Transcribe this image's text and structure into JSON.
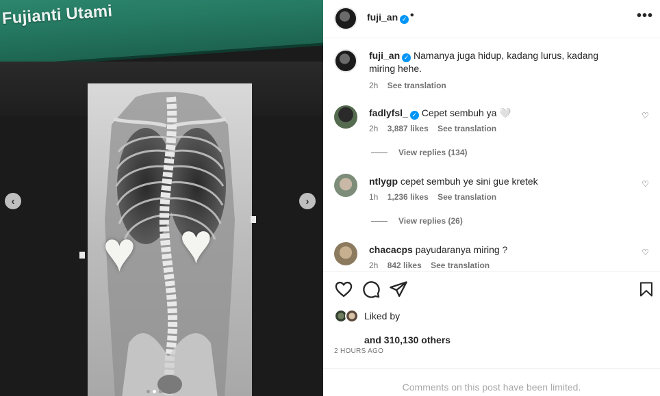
{
  "media": {
    "banner_name": "Fujianti Utami",
    "carousel_dots": 3,
    "active_dot": 2
  },
  "post": {
    "username": "fuji_an",
    "verified": true,
    "more_label": "•••",
    "caption": "Namanya juga hidup, kadang lurus, kadang miring hehe.",
    "caption_time": "2h",
    "see_translation": "See translation"
  },
  "comments": [
    {
      "user": "fadlyfsl_",
      "verified": true,
      "text": "Cepet sembuh ya 🤍",
      "time": "2h",
      "likes": "3,887 likes",
      "translation": "See translation",
      "replies": "View replies (134)"
    },
    {
      "user": "ntlygp",
      "verified": false,
      "text": "cepet sembuh ye sini gue kretek",
      "time": "1h",
      "likes": "1,236 likes",
      "translation": "See translation",
      "replies": "View replies (26)"
    },
    {
      "user": "chacacps",
      "verified": false,
      "text": "payudaranya miring ?",
      "time": "2h",
      "likes": "842 likes",
      "translation": "See translation"
    }
  ],
  "likes": {
    "liked_by": "Liked by",
    "others": "and 310,130 others"
  },
  "timestamp": "2 HOURS AGO",
  "limited_notice": "Comments on this post have been limited.",
  "colors": {
    "verified": "#0095f6",
    "secondary_text": "#737373",
    "banner": "#24765f"
  }
}
